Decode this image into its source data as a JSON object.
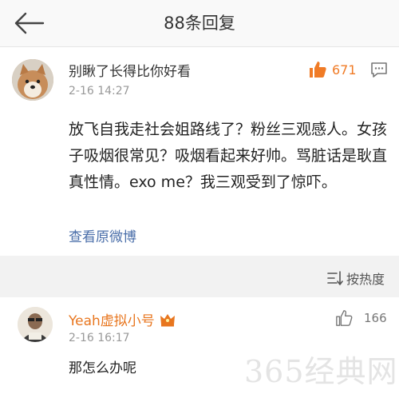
{
  "header": {
    "title": "88条回复"
  },
  "comment": {
    "username": "别瞅了长得比你好看",
    "time": "2-16 14:27",
    "likes": "671",
    "body": "放飞自我走社会姐路线了？粉丝三观感人。女孩子吸烟很常见？吸烟看起来好帅。骂脏话是耿直真性情。exo me？我三观受到了惊吓。",
    "view_original": "查看原微博"
  },
  "sort": {
    "label": "按热度"
  },
  "reply": {
    "username": "Yeah虚拟小号",
    "time": "2-16 16:17",
    "likes": "166",
    "body": "那怎么办呢"
  },
  "watermark": "365经典网",
  "colors": {
    "accent": "#f07b26",
    "link": "#4a6ea9",
    "username_vip": "#e8761f"
  },
  "icons": [
    "back-arrow-icon",
    "thumbs-up-icon",
    "reply-icon",
    "sort-icon",
    "crown-icon"
  ]
}
